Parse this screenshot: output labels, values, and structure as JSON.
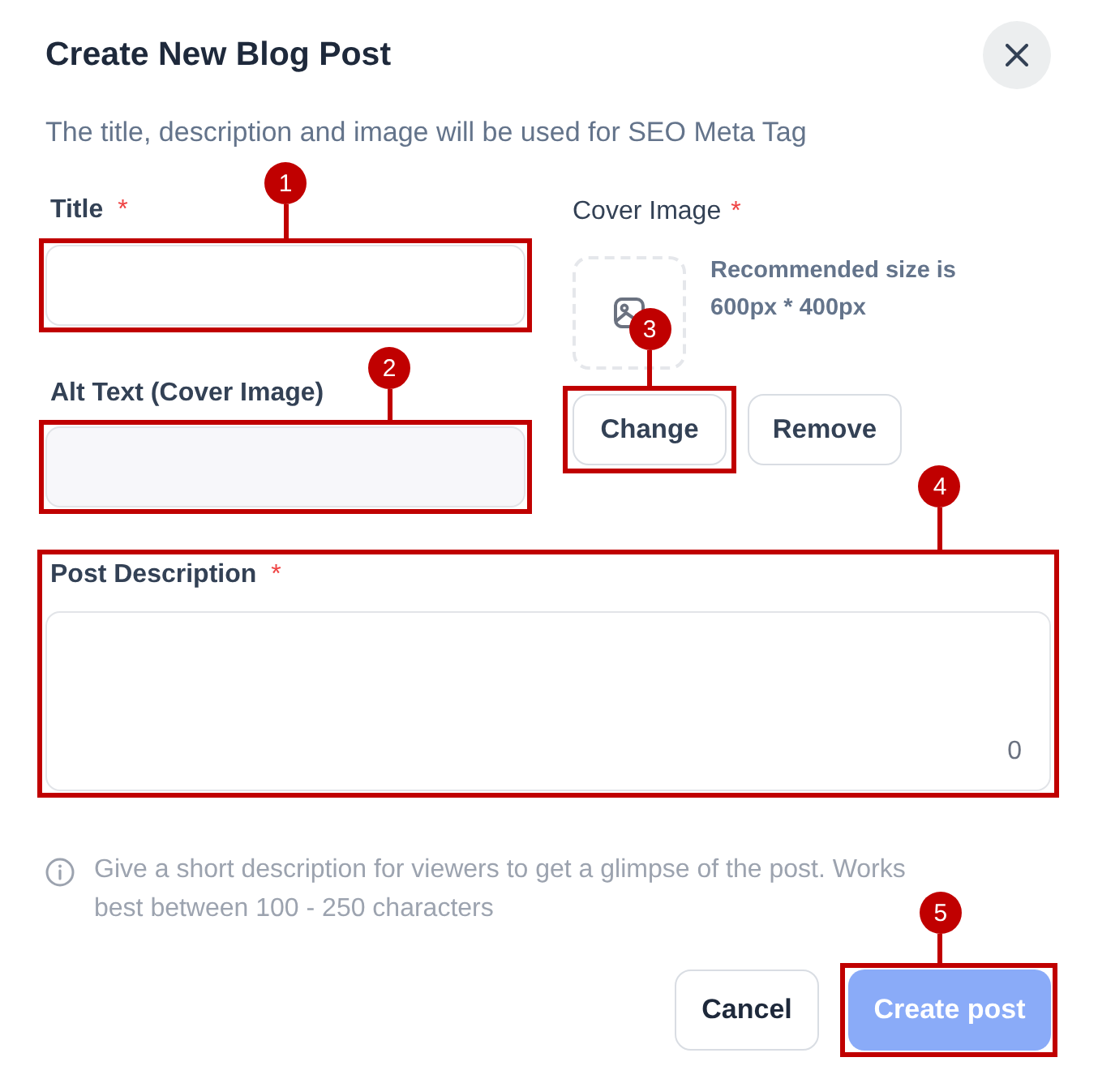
{
  "dialog": {
    "title": "Create New Blog Post",
    "subtitle": "The title, description and image will be used for SEO Meta Tag"
  },
  "fields": [
    {
      "kind": "outlined",
      "label": "Title",
      "required_mark": "*",
      "callout": "1"
    },
    {
      "kind": "filled",
      "label": "Alt Text (Cover Image)",
      "callout": "2"
    }
  ],
  "cover_image": {
    "label": "Cover Image",
    "required_mark": "*",
    "hint": "Recommended size is 600px * 400px",
    "buttons": [
      {
        "label": "Change",
        "callout": "3"
      },
      {
        "label": "Remove"
      }
    ]
  },
  "description": {
    "label": "Post Description",
    "required_mark": "*",
    "counter": "0",
    "callout": "4",
    "hint": "Give a short description for viewers to get a glimpse of the post. Works best between 100 - 250 characters"
  },
  "actions": [
    {
      "kind": "secondary",
      "label": "Cancel",
      "disabled": false
    },
    {
      "kind": "primary",
      "label": "Create post",
      "disabled": true,
      "callout": "5"
    }
  ]
}
